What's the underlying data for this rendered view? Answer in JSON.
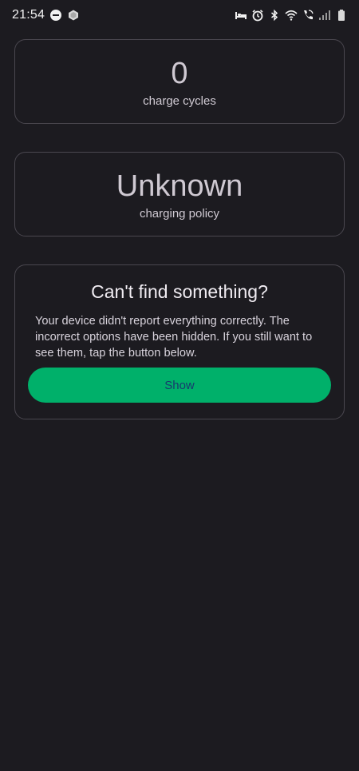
{
  "status_bar": {
    "time": "21:54",
    "icons": [
      "do-not-disturb-icon",
      "app-notification-icon",
      "bed-icon",
      "alarm-icon",
      "bluetooth-icon",
      "wifi-icon",
      "wifi-calling-icon",
      "signal-icon",
      "battery-icon"
    ]
  },
  "cycles_card": {
    "value": "0",
    "label": "charge cycles"
  },
  "policy_card": {
    "value": "Unknown",
    "label": "charging policy"
  },
  "hidden_card": {
    "title": "Can't find something?",
    "text": "Your device didn't report everything correctly. The incorrect options have been hidden. If you still want to see them, tap the button below.",
    "button_label": "Show"
  },
  "colors": {
    "background": "#1c1b20",
    "card_border": "#4a474f",
    "accent_button": "#00b06a",
    "button_text": "#173a6e"
  }
}
